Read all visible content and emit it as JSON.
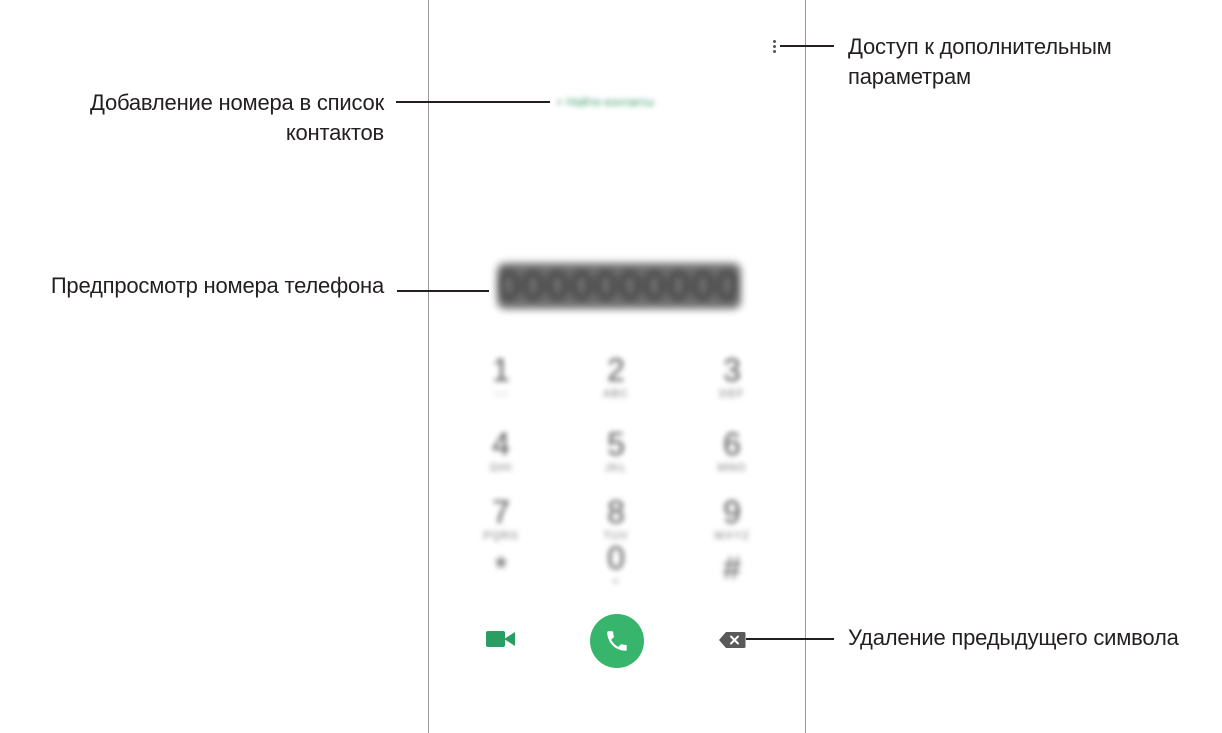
{
  "callouts": {
    "more_options": [
      "Доступ к дополнительным",
      "параметрам"
    ],
    "add_to_contacts": [
      "Добавление номера в список",
      "контактов"
    ],
    "number_preview": "Предпросмотр номера телефона",
    "delete_previous": "Удаление предыдущего символа"
  },
  "dialer": {
    "add_contact_label": "+ Найти контакты",
    "number_preview_text": "0000000000",
    "keys": [
      {
        "digit": "1",
        "sub": "◌◌"
      },
      {
        "digit": "2",
        "sub": "ABC"
      },
      {
        "digit": "3",
        "sub": "DEF"
      },
      {
        "digit": "4",
        "sub": "GHI"
      },
      {
        "digit": "5",
        "sub": "JKL"
      },
      {
        "digit": "6",
        "sub": "MNO"
      },
      {
        "digit": "7",
        "sub": "PQRS"
      },
      {
        "digit": "8",
        "sub": "TUV"
      },
      {
        "digit": "9",
        "sub": "WXYZ"
      },
      {
        "digit": "*",
        "sub": ""
      },
      {
        "digit": "0",
        "sub": "+"
      },
      {
        "digit": "#",
        "sub": ""
      }
    ]
  },
  "icons": {
    "more": "more-vertical-icon",
    "video_call": "video-camera-icon",
    "call": "phone-icon",
    "backspace": "backspace-icon"
  },
  "colors": {
    "accent_green": "#37b56d",
    "text": "#231f20"
  }
}
